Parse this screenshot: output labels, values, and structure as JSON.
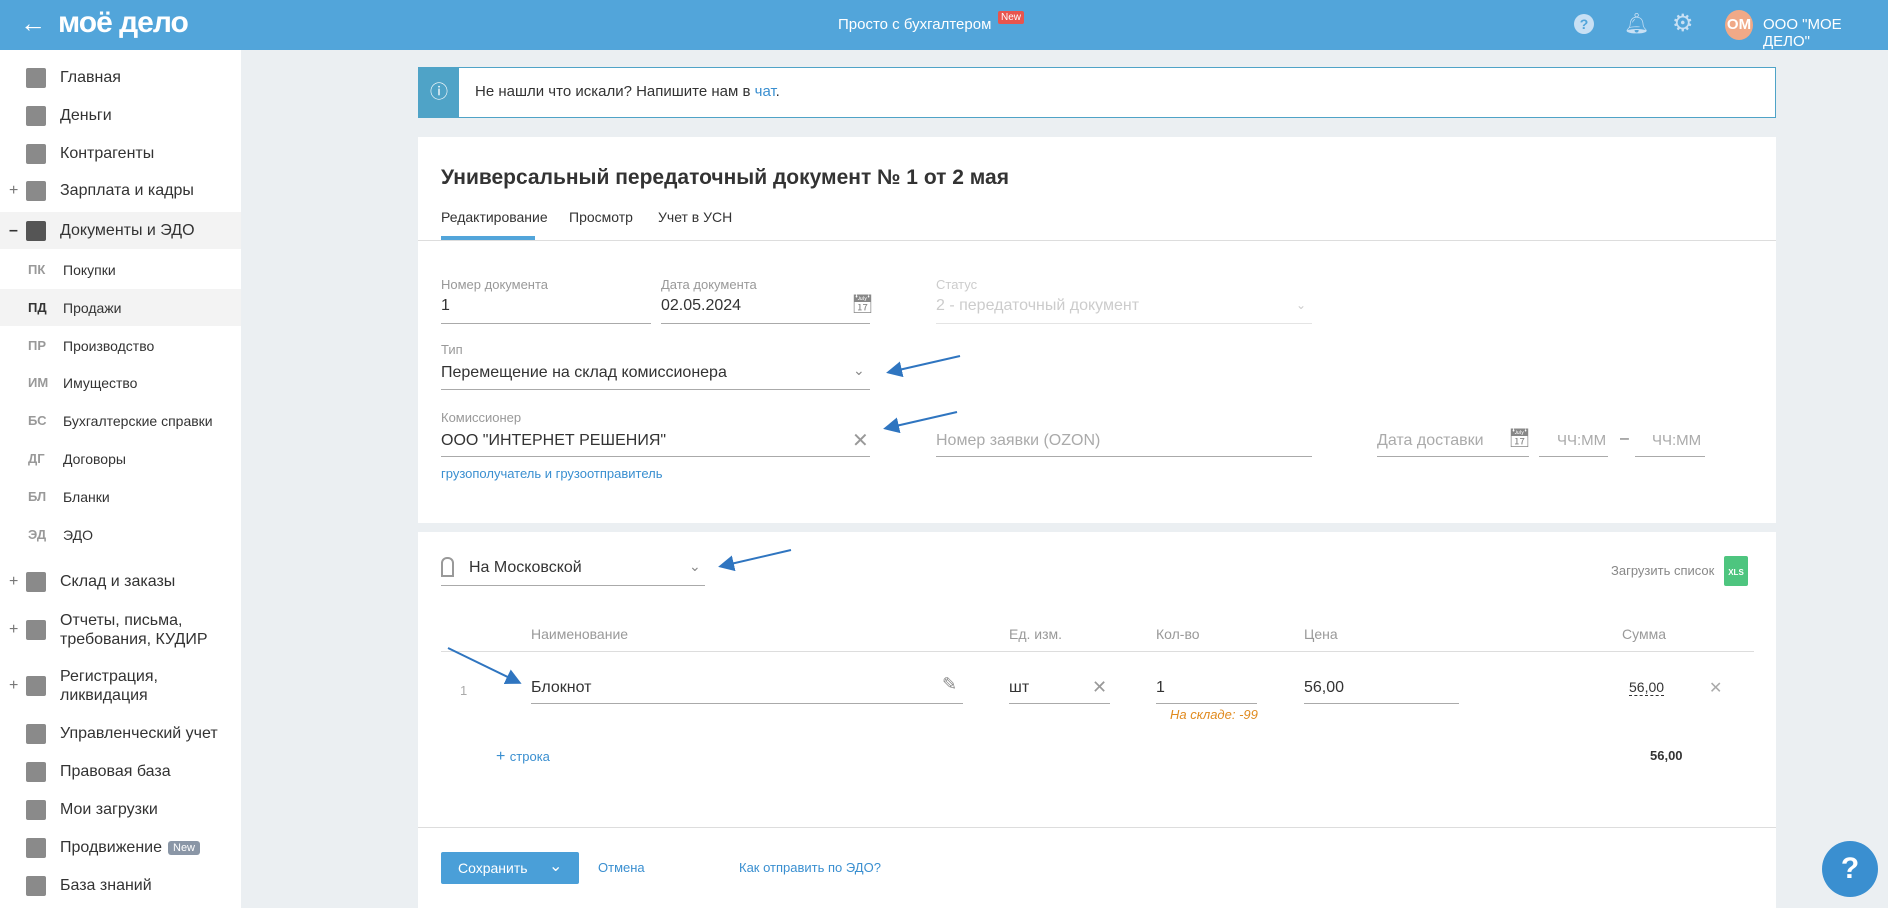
{
  "header": {
    "logo": "моё дело",
    "title": "Просто с бухгалтером",
    "title_badge": "New",
    "avatar_initials": "ОМ",
    "org_name": "ООО \"МОЕ ДЕЛО\""
  },
  "sidebar": {
    "items": [
      {
        "label": "Главная",
        "icon": "home-icon"
      },
      {
        "label": "Деньги",
        "icon": "money-icon"
      },
      {
        "label": "Контрагенты",
        "icon": "contractors-icon"
      },
      {
        "label": "Зарплата и кадры",
        "icon": "wallet-icon",
        "expander": "+"
      },
      {
        "label": "Документы и ЭДО",
        "icon": "folder-icon",
        "expander": "–"
      }
    ],
    "sub_items": [
      {
        "abbr": "ПК",
        "label": "Покупки"
      },
      {
        "abbr": "ПД",
        "label": "Продажи"
      },
      {
        "abbr": "ПР",
        "label": "Производство"
      },
      {
        "abbr": "ИМ",
        "label": "Имущество"
      },
      {
        "abbr": "БС",
        "label": "Бухгалтерские справки"
      },
      {
        "abbr": "ДГ",
        "label": "Договоры"
      },
      {
        "abbr": "БЛ",
        "label": "Бланки"
      },
      {
        "abbr": "ЭД",
        "label": "ЭДО"
      }
    ],
    "items2": [
      {
        "label": "Склад и заказы",
        "expander": "+"
      },
      {
        "label": "Отчеты, письма,",
        "label2": "требования, КУДИР",
        "expander": "+"
      },
      {
        "label": "Регистрация,",
        "label2": "ликвидация",
        "expander": "+"
      },
      {
        "label": "Управленческий учет"
      },
      {
        "label": "Правовая база"
      },
      {
        "label": "Мои загрузки"
      },
      {
        "label": "Продвижение",
        "badge": "New"
      },
      {
        "label": "База знаний"
      }
    ]
  },
  "notice": {
    "text": "Не нашли что искали? Напишите нам в ",
    "link": "чат",
    "end": "."
  },
  "doc": {
    "title": "Универсальный передаточный документ № 1 от 2 мая",
    "tabs": [
      "Редактирование",
      "Просмотр",
      "Учет в УСН"
    ],
    "number_label": "Номер документа",
    "number": "1",
    "date_label": "Дата документа",
    "date": "02.05.2024",
    "status_label": "Статус",
    "status": "2 - передаточный документ",
    "type_label": "Тип",
    "type": "Перемещение на склад комиссионера",
    "commissioner_label": "Комиссионер",
    "commissioner": "ООО \"ИНТЕРНЕТ РЕШЕНИЯ\"",
    "consignee_link": "грузополучатель и грузоотправитель",
    "order_placeholder": "Номер заявки (OZON)",
    "delivery_placeholder": "Дата доставки",
    "time_from": "ЧЧ:ММ",
    "time_dash": "–",
    "time_to": "ЧЧ:ММ"
  },
  "items": {
    "warehouse": "На Московской",
    "upload": "Загрузить список",
    "xls": "XLS",
    "columns": [
      "Наименование",
      "Ед. изм.",
      "Кол-во",
      "Цена",
      "Сумма"
    ],
    "rows": [
      {
        "n": "1",
        "name": "Блокнот",
        "unit": "шт",
        "qty": "1",
        "stock": "На складе: -99",
        "price": "56,00",
        "sum": "56,00"
      }
    ],
    "add_row": "строка",
    "total": "56,00"
  },
  "footer": {
    "save": "Сохранить",
    "cancel": "Отмена",
    "edo": "Как отправить по ЭДО?"
  },
  "colors": {
    "header": "#52a5da",
    "accent": "#3a8fd0",
    "save": "#4a9fd8",
    "warning": "#e08a1e",
    "arrow": "#2f75c0"
  }
}
